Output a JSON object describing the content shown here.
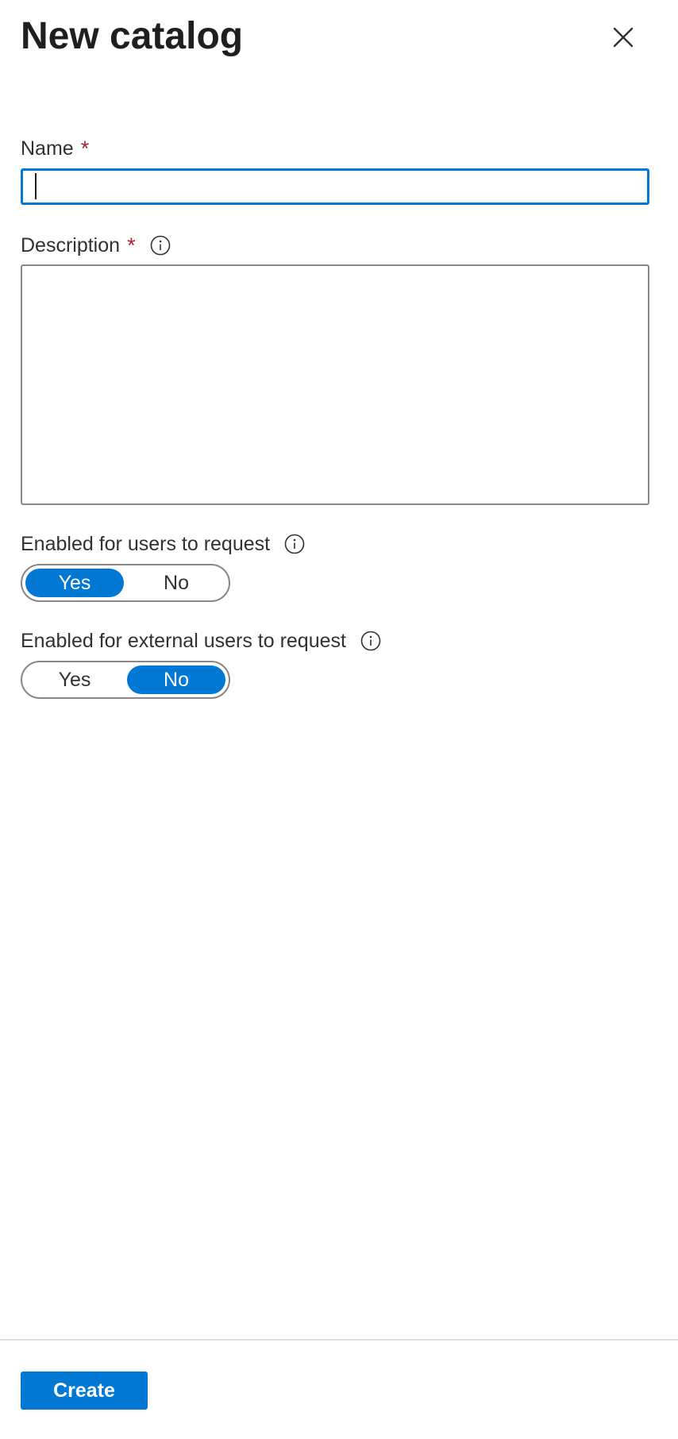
{
  "header": {
    "title": "New catalog",
    "close_icon": "close-icon"
  },
  "form": {
    "name": {
      "label": "Name",
      "required_marker": "*",
      "value": "",
      "placeholder": ""
    },
    "description": {
      "label": "Description",
      "required_marker": "*",
      "info_icon": "info-icon",
      "value": "",
      "placeholder": ""
    },
    "enabled_users": {
      "label": "Enabled for users to request",
      "info_icon": "info-icon",
      "options": [
        "Yes",
        "No"
      ],
      "selected": "Yes"
    },
    "enabled_external": {
      "label": "Enabled for external users to request",
      "info_icon": "info-icon",
      "options": [
        "Yes",
        "No"
      ],
      "selected": "No"
    }
  },
  "footer": {
    "create_label": "Create"
  },
  "colors": {
    "accent": "#0078d4",
    "required": "#a4262c",
    "border": "#8a8886",
    "text": "#323130"
  }
}
